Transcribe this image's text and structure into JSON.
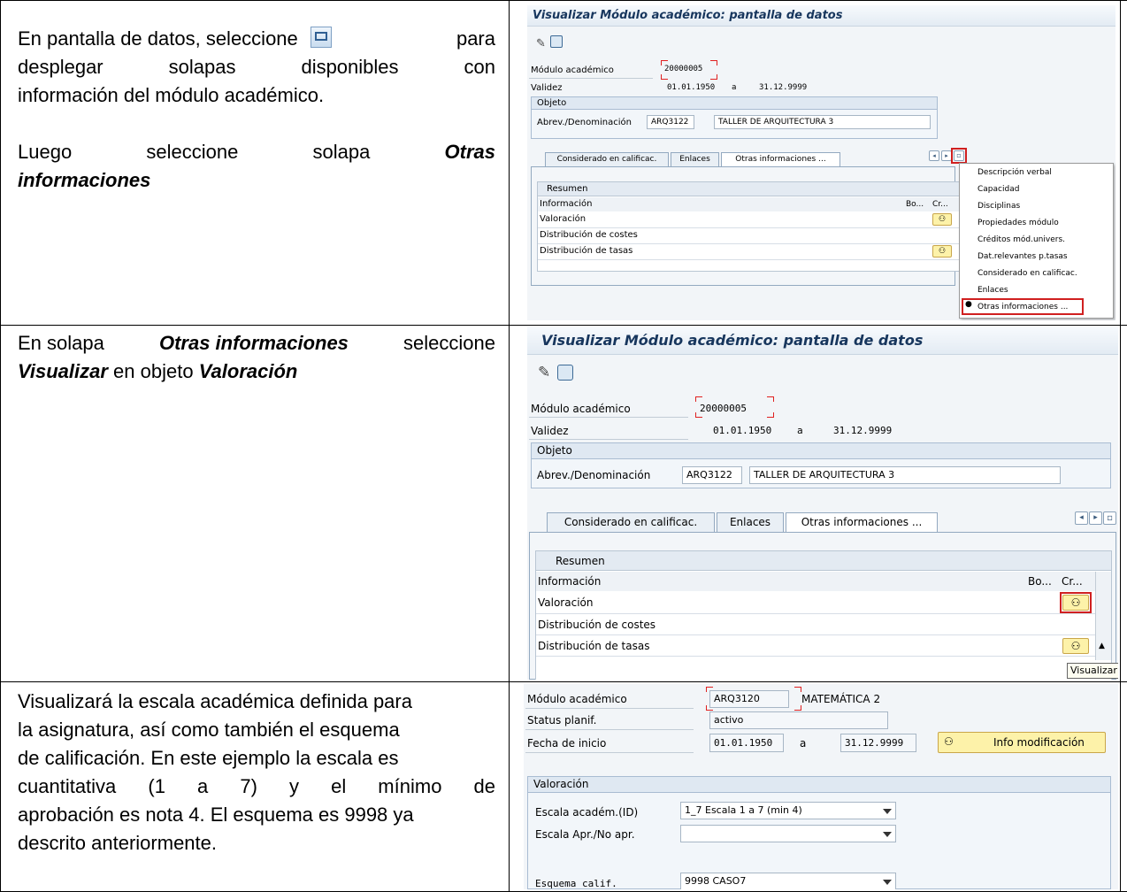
{
  "instructions": {
    "row1": {
      "line1a": "En pantalla de datos, seleccione",
      "line1b": "para",
      "line2": [
        "desplegar",
        "solapas",
        "disponibles",
        "con"
      ],
      "line3": "información del módulo académico.",
      "line4": [
        "Luego",
        "seleccione",
        "solapa"
      ],
      "line4_bold": "Otras",
      "line5_bold": "informaciones"
    },
    "row2": {
      "t1": "En solapa",
      "b1": "Otras informaciones",
      "t2": "seleccione",
      "b2": "Visualizar",
      "t3": "en objeto",
      "b3": "Valoración"
    },
    "row3": {
      "lines": [
        "Visualizará la escala académica definida para",
        "la asignatura, así como también el esquema",
        "de calificación. En este ejemplo la escala es",
        "cuantitativa (1 a 7) y el mínimo de",
        "aprobación es nota 4. El esquema es 9998 ya",
        "descrito anteriormente."
      ]
    }
  },
  "screen1": {
    "title": "Visualizar Módulo académico: pantalla de datos",
    "modulo_label": "Módulo académico",
    "modulo_value": "20000005",
    "validez_label": "Validez",
    "validez_from": "01.01.1950",
    "validez_a": "a",
    "validez_to": "31.12.9999",
    "objeto_label": "Objeto",
    "abrev_label": "Abrev./Denominación",
    "abrev_value": "ARQ3122",
    "denom_value": "TALLER DE ARQUITECTURA 3",
    "tabs": [
      "Considerado en calificac.",
      "Enlaces",
      "Otras informaciones ..."
    ],
    "resumen": "Resumen",
    "col_info": "Información",
    "col_bo": "Bo...",
    "col_cr": "Cr...",
    "rows": [
      "Valoración",
      "Distribución de costes",
      "Distribución de tasas"
    ],
    "menu": [
      "Descripción verbal",
      "Capacidad",
      "Disciplinas",
      "Propiedades módulo",
      "Créditos mód.univers.",
      "Dat.relevantes p.tasas",
      "Considerado en calificac.",
      "Enlaces",
      "Otras informaciones ..."
    ]
  },
  "screen2": {
    "title": "Visualizar Módulo académico: pantalla de datos",
    "modulo_label": "Módulo académico",
    "modulo_value": "20000005",
    "validez_label": "Validez",
    "validez_from": "01.01.1950",
    "validez_a": "a",
    "validez_to": "31.12.9999",
    "objeto_label": "Objeto",
    "abrev_label": "Abrev./Denominación",
    "abrev_value": "ARQ3122",
    "denom_value": "TALLER DE ARQUITECTURA 3",
    "tabs": [
      "Considerado en calificac.",
      "Enlaces",
      "Otras informaciones ..."
    ],
    "resumen": "Resumen",
    "col_info": "Información",
    "col_bo": "Bo...",
    "col_cr": "Cr...",
    "rows": [
      "Valoración",
      "Distribución de costes",
      "Distribución de tasas"
    ],
    "tooltip": "Visualizar"
  },
  "screen3": {
    "modulo_label": "Módulo académico",
    "modulo_value": "ARQ3120",
    "modulo_name": "MATEMÁTICA 2",
    "status_label": "Status planif.",
    "status_value": "activo",
    "fecha_label": "Fecha de inicio",
    "fecha_from": "01.01.1950",
    "fecha_a": "a",
    "fecha_to": "31.12.9999",
    "info_btn": "Info modificación",
    "valoracion_label": "Valoración",
    "escala_label": "Escala académ.(ID)",
    "escala_value": "1_7 Escala 1 a 7 (min 4)",
    "apr_label": "Escala Apr./No apr.",
    "apr_value": "",
    "esquema_label": "Esquema calif.",
    "esquema_value": "9998 CASO7"
  },
  "colors": {
    "title_blue": "#17365d",
    "highlight_red": "#d02020",
    "button_yellow": "#fdf2a9"
  }
}
